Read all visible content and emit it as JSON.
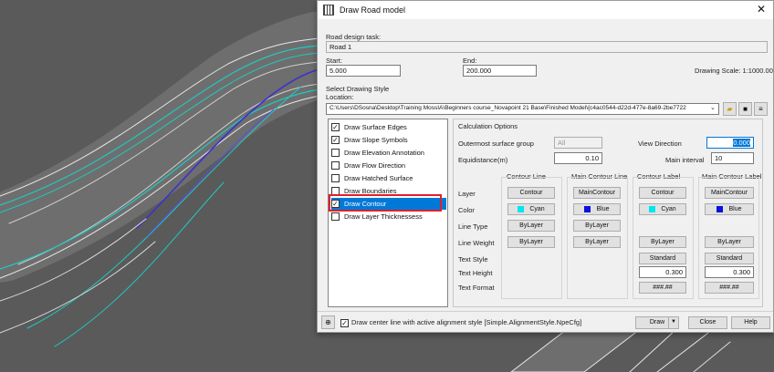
{
  "window": {
    "title": "Draw Road model"
  },
  "task": {
    "label": "Road design task:",
    "value": "Road 1"
  },
  "start": {
    "label": "Start:",
    "value": "5.000"
  },
  "end": {
    "label": "End:",
    "value": "200.000"
  },
  "scale": {
    "text": "Drawing Scale: 1:1000.00"
  },
  "style": {
    "section_label": "Select Drawing Style",
    "location_label": "Location:",
    "location_value": "C:\\Users\\DSosna\\Desktop\\Training MossIA\\Beginners course_Novapoint 21 Base\\Finished Model\\{c4ac0544-d22d-477e-8a69-2be7722"
  },
  "draw_items": [
    {
      "label": "Draw Surface Edges",
      "check": "✓"
    },
    {
      "label": "Draw Slope Symbols",
      "check": "✓"
    },
    {
      "label": "Draw Elevation Annotation",
      "check": ""
    },
    {
      "label": "Draw Flow Direction",
      "check": ""
    },
    {
      "label": "Draw Hatched Surface",
      "check": ""
    },
    {
      "label": "Draw Boundaries",
      "check": ""
    },
    {
      "label": "Draw Contour",
      "check": "✓"
    },
    {
      "label": "Draw Layer Thicknessess",
      "check": ""
    }
  ],
  "calc": {
    "title": "Calculation Options",
    "outermost_label": "Outermost surface group",
    "outermost_value": "All",
    "view_dir_label": "View Direction",
    "view_dir_value": "0.000",
    "equidistance_label": "Equidistance(m)",
    "equidistance_value": "0.10",
    "main_interval_label": "Main interval",
    "main_interval_value": "10"
  },
  "columns": [
    "Contour Line",
    "Main Contour Line",
    "Contour Label",
    "Main Contour Label"
  ],
  "rows": [
    "Layer",
    "Color",
    "Line Type",
    "Line Weight",
    "Text Style",
    "Text Height",
    "Text Format"
  ],
  "cells": {
    "contour_line": {
      "layer": "Contour",
      "color": "Cyan",
      "line_type": "ByLayer",
      "line_weight": "ByLayer"
    },
    "main_contour_line": {
      "layer": "MainContour",
      "color": "Blue",
      "line_type": "ByLayer",
      "line_weight": "ByLayer"
    },
    "contour_label": {
      "layer": "Contour",
      "color": "Cyan",
      "line_weight": "ByLayer",
      "text_style": "Standard",
      "text_height": "0.300",
      "text_format": "###.##"
    },
    "main_contour_label": {
      "layer": "MainContour",
      "color": "Blue",
      "line_weight": "ByLayer",
      "text_style": "Standard",
      "text_height": "0.300",
      "text_format": "###.##"
    }
  },
  "colors": {
    "cyan": "#00e5ee",
    "blue": "#0a10e0",
    "selection": "#0078d7",
    "highlight": "#e0202a"
  },
  "footer": {
    "center_line_label": "Draw center line with active alignment style [Simple.AlignmentStyle.NpeCfg]",
    "draw": "Draw",
    "close": "Close",
    "help": "Help"
  }
}
